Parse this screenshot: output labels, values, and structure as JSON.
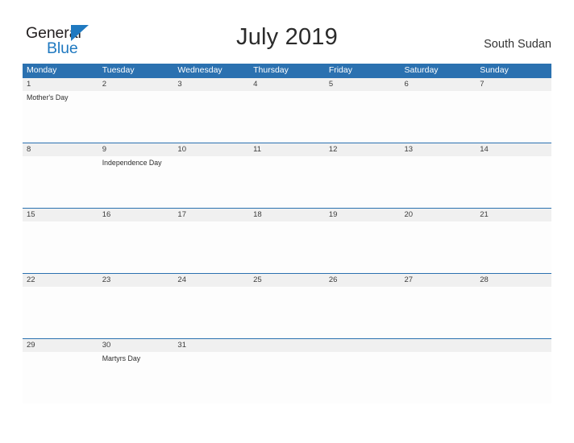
{
  "brand": {
    "name_part1": "General",
    "name_part2": "Blue",
    "flag_icon": "blue-flag-triangle-icon",
    "accent_color": "#1f79c0"
  },
  "header": {
    "title": "July 2019",
    "country": "South Sudan"
  },
  "theme": {
    "header_blue": "#2b71b0",
    "date_band_gray": "#f0f0f0",
    "body_white": "#fdfdfd",
    "text_dark": "#2b2b2b"
  },
  "calendar": {
    "month": "July",
    "year": "2019",
    "weekday_headers": [
      "Monday",
      "Tuesday",
      "Wednesday",
      "Thursday",
      "Friday",
      "Saturday",
      "Sunday"
    ],
    "weeks": [
      {
        "dates": [
          "1",
          "2",
          "3",
          "4",
          "5",
          "6",
          "7"
        ],
        "events": [
          "Mother's Day",
          "",
          "",
          "",
          "",
          "",
          ""
        ]
      },
      {
        "dates": [
          "8",
          "9",
          "10",
          "11",
          "12",
          "13",
          "14"
        ],
        "events": [
          "",
          "Independence Day",
          "",
          "",
          "",
          "",
          ""
        ]
      },
      {
        "dates": [
          "15",
          "16",
          "17",
          "18",
          "19",
          "20",
          "21"
        ],
        "events": [
          "",
          "",
          "",
          "",
          "",
          "",
          ""
        ]
      },
      {
        "dates": [
          "22",
          "23",
          "24",
          "25",
          "26",
          "27",
          "28"
        ],
        "events": [
          "",
          "",
          "",
          "",
          "",
          "",
          ""
        ]
      },
      {
        "dates": [
          "29",
          "30",
          "31",
          "",
          "",
          "",
          ""
        ],
        "events": [
          "",
          "Martyrs Day",
          "",
          "",
          "",
          "",
          ""
        ]
      }
    ]
  }
}
